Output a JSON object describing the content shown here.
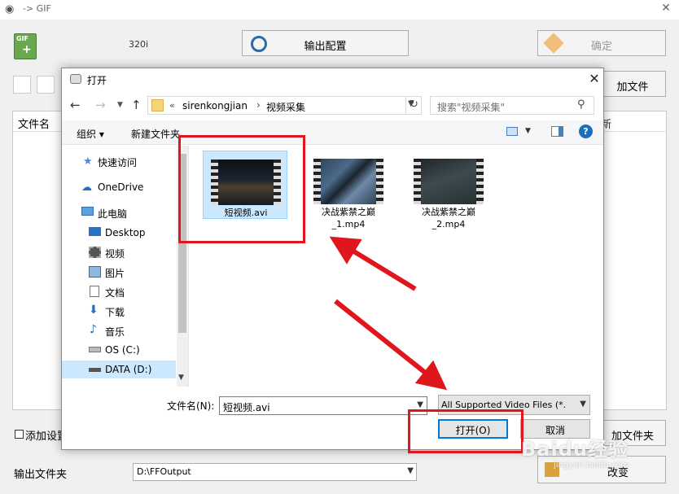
{
  "background_app": {
    "title": "-> GIF",
    "resolution": "320i",
    "output_config_label": "输出配置",
    "confirm_label": "确定",
    "add_file_label": "加文件",
    "column_filename": "文件名",
    "column_right_partial": "新",
    "add_settings_label": "添加设置",
    "output_folder_label": "输出文件夹",
    "output_folder_value": "D:\\FFOutput",
    "bottom_btn_1_label": "加文件夹",
    "bottom_btn_2_label": "改变"
  },
  "dialog": {
    "title": "打开",
    "address": {
      "chevrons": "«",
      "crumbs": [
        "sirenkongjian",
        "视频采集"
      ],
      "separator": "›"
    },
    "search_placeholder": "搜索\"视频采集\"",
    "toolbar": {
      "organize": "组织 ▾",
      "new_folder": "新建文件夹"
    },
    "nav_items": [
      {
        "label": "快速访问",
        "icon": "star-icon"
      },
      {
        "label": "OneDrive",
        "icon": "cloud-icon"
      },
      {
        "label": "此电脑",
        "icon": "computer-icon"
      },
      {
        "label": "Desktop",
        "icon": "desktop-icon"
      },
      {
        "label": "视频",
        "icon": "video-folder-icon"
      },
      {
        "label": "图片",
        "icon": "picture-folder-icon"
      },
      {
        "label": "文档",
        "icon": "document-folder-icon"
      },
      {
        "label": "下载",
        "icon": "download-icon"
      },
      {
        "label": "音乐",
        "icon": "music-icon"
      },
      {
        "label": "OS (C:)",
        "icon": "drive-c-icon"
      },
      {
        "label": "DATA (D:)",
        "icon": "drive-d-icon",
        "selected": true
      }
    ],
    "files": [
      {
        "name": "短视频.avi",
        "selected": true
      },
      {
        "name": "决战紫禁之巅_1.mp4"
      },
      {
        "name": "决战紫禁之巅_2.mp4"
      }
    ],
    "filename_label": "文件名(N):",
    "filename_value": "短视频.avi",
    "filetype_value": "All Supported Video Files (*.",
    "open_label": "打开(O)",
    "cancel_label": "取消"
  },
  "watermark": {
    "text": "Baidu经验",
    "sub": "jingyan.baidu.com"
  },
  "colors": {
    "annotation_red": "#e0161d",
    "selection_blue": "#cce8ff",
    "accent_blue": "#0078d7"
  }
}
